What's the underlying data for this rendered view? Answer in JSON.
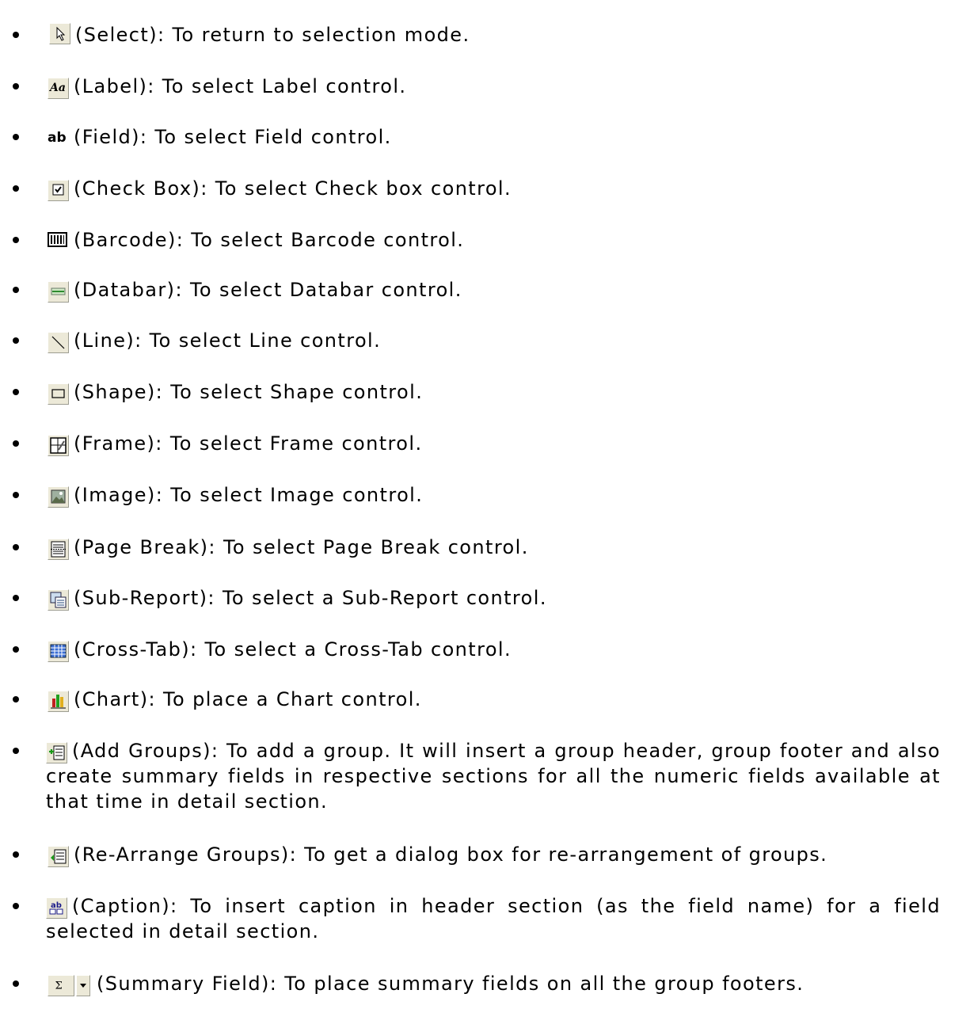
{
  "items": [
    {
      "icon": "select-arrow-icon",
      "text": "(Select): To return to selection mode."
    },
    {
      "icon": "label-aa-icon",
      "text": "(Label): To select Label control."
    },
    {
      "icon": "field-abl-icon",
      "text": "(Field): To select Field control."
    },
    {
      "icon": "checkbox-icon",
      "text": "(Check Box): To select Check box control."
    },
    {
      "icon": "barcode-icon",
      "text": "(Barcode): To select Barcode control."
    },
    {
      "icon": "databar-icon",
      "text": "(Databar): To select Databar control."
    },
    {
      "icon": "line-icon",
      "text": "(Line): To select Line control."
    },
    {
      "icon": "shape-icon",
      "text": "(Shape): To select Shape control."
    },
    {
      "icon": "frame-icon",
      "text": "(Frame): To select Frame control."
    },
    {
      "icon": "image-icon",
      "text": "(Image): To select Image control."
    },
    {
      "icon": "page-break-icon",
      "text": "(Page Break): To select Page Break control."
    },
    {
      "icon": "sub-report-icon",
      "text": "(Sub-Report):  To select a Sub-Report control."
    },
    {
      "icon": "cross-tab-icon",
      "text": "(Cross-Tab): To select a Cross-Tab control."
    },
    {
      "icon": "chart-icon",
      "text": "(Chart):  To place a Chart control."
    },
    {
      "icon": "add-groups-icon",
      "text": "(Add Groups): To add a group.  It will insert a group header, group footer and also create summary fields in respective sections for all the numeric fields available at that time in detail section."
    },
    {
      "icon": "rearrange-groups-icon",
      "text": "(Re-Arrange Groups):  To get a dialog box for re-arrangement of groups."
    },
    {
      "icon": "caption-icon",
      "text": "(Caption): To insert caption in header section (as the field name) for a field selected in detail section."
    },
    {
      "icon": "summary-sigma-icon",
      "text": "(Summary Field): To place summary fields on all the group footers."
    }
  ]
}
